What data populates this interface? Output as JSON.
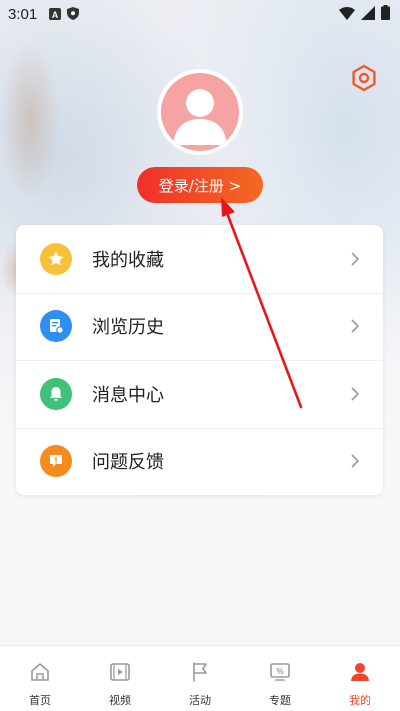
{
  "status_bar": {
    "time": "3:01"
  },
  "profile": {
    "login_label": "登录/注册 >"
  },
  "menu": {
    "items": [
      {
        "label": "我的收藏",
        "icon": "star-icon",
        "color": "#f7c23a"
      },
      {
        "label": "浏览历史",
        "icon": "history-icon",
        "color": "#2e8ff0"
      },
      {
        "label": "消息中心",
        "icon": "bell-icon",
        "color": "#3ec27a"
      },
      {
        "label": "问题反馈",
        "icon": "feedback-icon",
        "color": "#f58a1f"
      }
    ]
  },
  "tabbar": {
    "tabs": [
      {
        "label": "首页",
        "icon": "home-icon",
        "active": false
      },
      {
        "label": "视频",
        "icon": "video-icon",
        "active": false
      },
      {
        "label": "活动",
        "icon": "flag-icon",
        "active": false
      },
      {
        "label": "专题",
        "icon": "topic-icon",
        "active": false
      },
      {
        "label": "我的",
        "icon": "profile-icon",
        "active": true
      }
    ]
  },
  "colors": {
    "accent": "#f0462a",
    "login_gradient_start": "#f0302a",
    "login_gradient_end": "#f26a22",
    "annotation_arrow": "#e8161b"
  }
}
